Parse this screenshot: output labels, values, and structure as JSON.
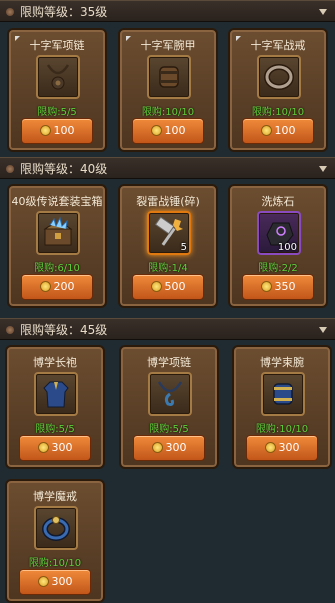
{
  "sections": [
    {
      "label": "限购等级：35级",
      "items": [
        {
          "name": "十字军项链",
          "limit": "限购:5/5",
          "price": "100",
          "icon": "necklace-icon"
        },
        {
          "name": "十字军腕甲",
          "limit": "限购:10/10",
          "price": "100",
          "icon": "bracer-icon"
        },
        {
          "name": "十字军战戒",
          "limit": "限购:10/10",
          "price": "100",
          "icon": "ring-icon"
        }
      ]
    },
    {
      "label": "限购等级：40级",
      "items": [
        {
          "name": "40级传说套装宝箱",
          "limit": "限购:6/10",
          "price": "200",
          "icon": "chest-icon"
        },
        {
          "name": "裂雷战锤(碎)",
          "limit": "限购:1/4",
          "price": "500",
          "icon": "hammer-fragment-icon",
          "qty": "5"
        },
        {
          "name": "洗炼石",
          "limit": "限购:2/2",
          "price": "350",
          "icon": "refine-stone-icon",
          "qty": "100"
        }
      ]
    },
    {
      "label": "限购等级：45级",
      "items": [
        {
          "name": "博学长袍",
          "limit": "限购:5/5",
          "price": "300",
          "icon": "robe-icon"
        },
        {
          "name": "博学项链",
          "limit": "限购:5/5",
          "price": "300",
          "icon": "necklace-icon"
        },
        {
          "name": "博学束腕",
          "limit": "限购:10/10",
          "price": "300",
          "icon": "bracer-icon"
        },
        {
          "name": "博学魔戒",
          "limit": "限购:10/10",
          "price": "300",
          "icon": "ring-icon"
        }
      ]
    }
  ]
}
